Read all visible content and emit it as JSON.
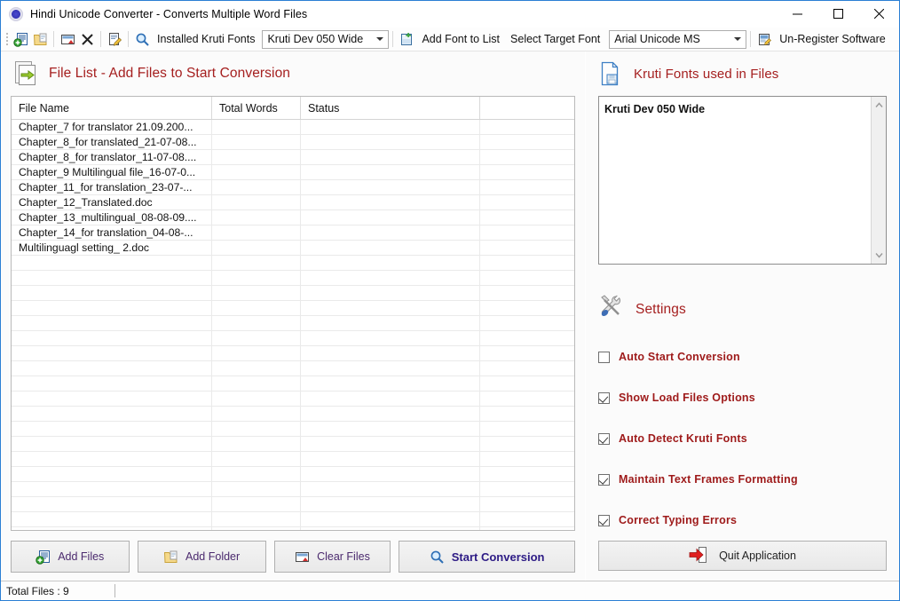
{
  "window": {
    "title": "Hindi Unicode Converter - Converts Multiple Word Files",
    "app_icon": "app-globe-icon",
    "minimize": "minimize-icon",
    "maximize": "maximize-icon",
    "close": "close-icon"
  },
  "toolbar": {
    "icons": [
      "add-files-icon",
      "add-folder-icon",
      "clear-files-icon",
      "remove-icon",
      "edit-icon",
      "search-icon"
    ],
    "installed_fonts_label": "Installed Kruti Fonts",
    "installed_fonts_value": "Kruti Dev 050 Wide",
    "add_font_label": "Add Font to List",
    "add_font_icon": "add-font-icon",
    "target_font_label": "Select Target Font",
    "target_font_value": "Arial Unicode MS",
    "unregister_label": "Un-Register Software",
    "unregister_icon": "unregister-icon"
  },
  "file_list": {
    "header_icon": "file-export-icon",
    "header_title": "File List - Add Files to Start Conversion",
    "columns": [
      "File Name",
      "Total Words",
      "Status",
      ""
    ],
    "rows": [
      {
        "name": "Chapter_7 for translator 21.09.200...",
        "words": "",
        "status": ""
      },
      {
        "name": "Chapter_8_for translated_21-07-08...",
        "words": "",
        "status": ""
      },
      {
        "name": "Chapter_8_for translator_11-07-08....",
        "words": "",
        "status": ""
      },
      {
        "name": "Chapter_9 Multilingual file_16-07-0...",
        "words": "",
        "status": ""
      },
      {
        "name": "Chapter_11_for translation_23-07-...",
        "words": "",
        "status": ""
      },
      {
        "name": "Chapter_12_Translated.doc",
        "words": "",
        "status": ""
      },
      {
        "name": "Chapter_13_multilingual_08-08-09....",
        "words": "",
        "status": ""
      },
      {
        "name": "Chapter_14_for translation_04-08-...",
        "words": "",
        "status": ""
      },
      {
        "name": "Multilinguagl setting_ 2.doc",
        "words": "",
        "status": ""
      }
    ],
    "empty_row_count": 19
  },
  "actions": {
    "add_files": "Add Files",
    "add_files_icon": "add-files-icon",
    "add_folder": "Add Folder",
    "add_folder_icon": "folder-icon",
    "clear_files": "Clear Files",
    "clear_files_icon": "clear-list-icon",
    "start_conversion": "Start Conversion",
    "start_conversion_icon": "magnifier-icon"
  },
  "fonts_panel": {
    "header_icon": "document-save-icon",
    "header_title": "Kruti Fonts used in Files",
    "items": [
      "Kruti Dev 050 Wide"
    ],
    "scroll_up_icon": "chevron-up-icon",
    "scroll_down_icon": "chevron-down-icon"
  },
  "settings": {
    "header_icon": "tools-icon",
    "header_title": "Settings",
    "options": [
      {
        "label": "Auto Start Conversion",
        "checked": false
      },
      {
        "label": "Show Load Files Options",
        "checked": true
      },
      {
        "label": "Auto Detect Kruti Fonts",
        "checked": true
      },
      {
        "label": "Maintain Text Frames Formatting",
        "checked": true
      },
      {
        "label": "Correct Typing Errors",
        "checked": true
      }
    ]
  },
  "quit": {
    "label": "Quit Application",
    "icon": "exit-door-icon"
  },
  "statusbar": {
    "total_files": "Total Files :  9"
  },
  "colors": {
    "accent_red": "#a51f1f",
    "label_red": "#9e1a1a",
    "start_purple": "#2d1b85",
    "button_text": "#4b2a6e",
    "window_border": "#2b7fd4"
  }
}
